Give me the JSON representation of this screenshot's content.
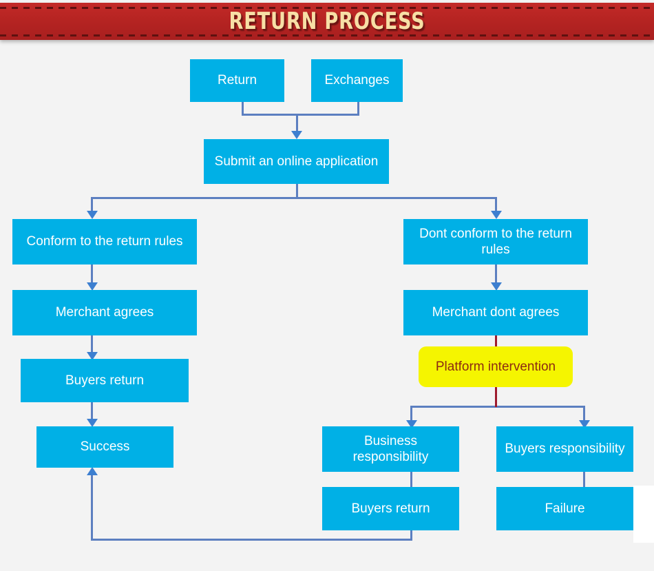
{
  "header": {
    "title": "RETURN PROCESS",
    "band_color": "#b62422",
    "title_color": "#f7dfa6"
  },
  "canvas": {
    "background_color": "#f3f3f3",
    "node_color": "#00b0e6",
    "node_text_color": "#ffffff",
    "highlight_color": "#f5f500",
    "highlight_text_color": "#8c2a12",
    "connector_color": "#5c7fc0",
    "arrow_color": "#3d7fd0",
    "red_connector_color": "#9e1b2d"
  },
  "chart_data": {
    "type": "diagram",
    "title": "RETURN PROCESS",
    "nodes": [
      {
        "id": "return",
        "label": "Return",
        "style": "primary"
      },
      {
        "id": "exchanges",
        "label": "Exchanges",
        "style": "primary"
      },
      {
        "id": "submit",
        "label": "Submit an online application",
        "style": "primary"
      },
      {
        "id": "conform",
        "label": "Conform to the return rules",
        "style": "primary"
      },
      {
        "id": "dont-conform",
        "label": "Dont conform to the return rules",
        "style": "primary"
      },
      {
        "id": "merchant-agrees",
        "label": "Merchant agrees",
        "style": "primary"
      },
      {
        "id": "merchant-dont",
        "label": "Merchant dont agrees",
        "style": "primary"
      },
      {
        "id": "buyers-return-l",
        "label": "Buyers return",
        "style": "primary"
      },
      {
        "id": "platform",
        "label": "Platform intervention",
        "style": "highlight"
      },
      {
        "id": "success",
        "label": "Success",
        "style": "primary"
      },
      {
        "id": "business-resp",
        "label": "Business responsibility",
        "style": "primary"
      },
      {
        "id": "buyers-resp",
        "label": "Buyers responsibility",
        "style": "primary"
      },
      {
        "id": "buyers-return-b",
        "label": "Buyers return",
        "style": "primary"
      },
      {
        "id": "failure",
        "label": "Failure",
        "style": "primary"
      }
    ],
    "edges": [
      {
        "from": "return",
        "to": "submit"
      },
      {
        "from": "exchanges",
        "to": "submit"
      },
      {
        "from": "submit",
        "to": "conform"
      },
      {
        "from": "submit",
        "to": "dont-conform"
      },
      {
        "from": "conform",
        "to": "merchant-agrees"
      },
      {
        "from": "merchant-agrees",
        "to": "buyers-return-l"
      },
      {
        "from": "buyers-return-l",
        "to": "success"
      },
      {
        "from": "dont-conform",
        "to": "merchant-dont"
      },
      {
        "from": "merchant-dont",
        "to": "platform"
      },
      {
        "from": "platform",
        "to": "business-resp"
      },
      {
        "from": "platform",
        "to": "buyers-resp"
      },
      {
        "from": "business-resp",
        "to": "buyers-return-b"
      },
      {
        "from": "buyers-resp",
        "to": "failure"
      },
      {
        "from": "buyers-return-b",
        "to": "success"
      }
    ]
  },
  "nodes": {
    "return": {
      "label": "Return"
    },
    "exchanges": {
      "label": "Exchanges"
    },
    "submit": {
      "label": "Submit an online application"
    },
    "conform": {
      "label": "Conform to the return rules"
    },
    "dont_conform": {
      "label": "Dont conform to the return rules"
    },
    "merchant_agrees": {
      "label": "Merchant agrees"
    },
    "merchant_dont_agrees": {
      "label": "Merchant dont agrees"
    },
    "buyers_return_left": {
      "label": "Buyers return"
    },
    "platform_intervention": {
      "label": "Platform intervention"
    },
    "success": {
      "label": "Success"
    },
    "business_responsibility": {
      "label": "Business responsibility"
    },
    "buyers_responsibility": {
      "label": "Buyers responsibility"
    },
    "buyers_return_bottom": {
      "label": "Buyers return"
    },
    "failure": {
      "label": "Failure"
    }
  }
}
